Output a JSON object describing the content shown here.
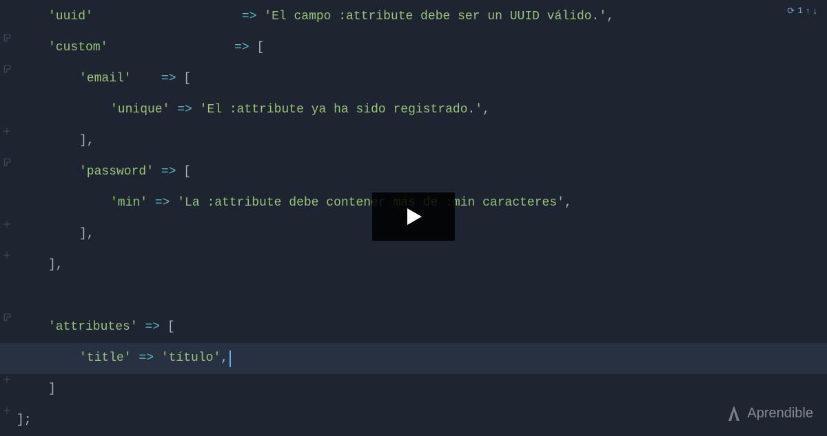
{
  "badge": {
    "symbol": "⟳",
    "count": "1",
    "up": "↑",
    "down": "↓"
  },
  "lines": {
    "l1_key": "'uuid'",
    "l1_pad": "                    ",
    "l1_arrow": "=> ",
    "l1_val": "'El campo :attribute debe ser un UUID válido.'",
    "l1_end": ",",
    "l2_key": "'custom'",
    "l2_pad": "                 ",
    "l2_arrow": "=> ",
    "l2_br": "[",
    "l3_key": "'email'",
    "l3_pad": "    ",
    "l3_arrow": "=> ",
    "l3_br": "[",
    "l4_key": "'unique'",
    "l4_arrow": " => ",
    "l4_val": "'El :attribute ya ha sido registrado.'",
    "l4_end": ",",
    "l5": "],",
    "l6_key": "'password'",
    "l6_arrow": " => ",
    "l6_br": "[",
    "l7_key": "'min'",
    "l7_arrow": " => ",
    "l7_val": "'La :attribute debe contener más de :min caracteres'",
    "l7_end": ",",
    "l8": "],",
    "l9": "],",
    "blank": "",
    "l11_key": "'attributes'",
    "l11_arrow": " => ",
    "l11_br": "[",
    "l12_key": "'title'",
    "l12_arrow": " => ",
    "l12_val": "'título'",
    "l12_end": ",",
    "l13": "]",
    "l14": "];"
  },
  "watermark": {
    "brand_light": "Aprend",
    "brand_bold": "ible"
  }
}
